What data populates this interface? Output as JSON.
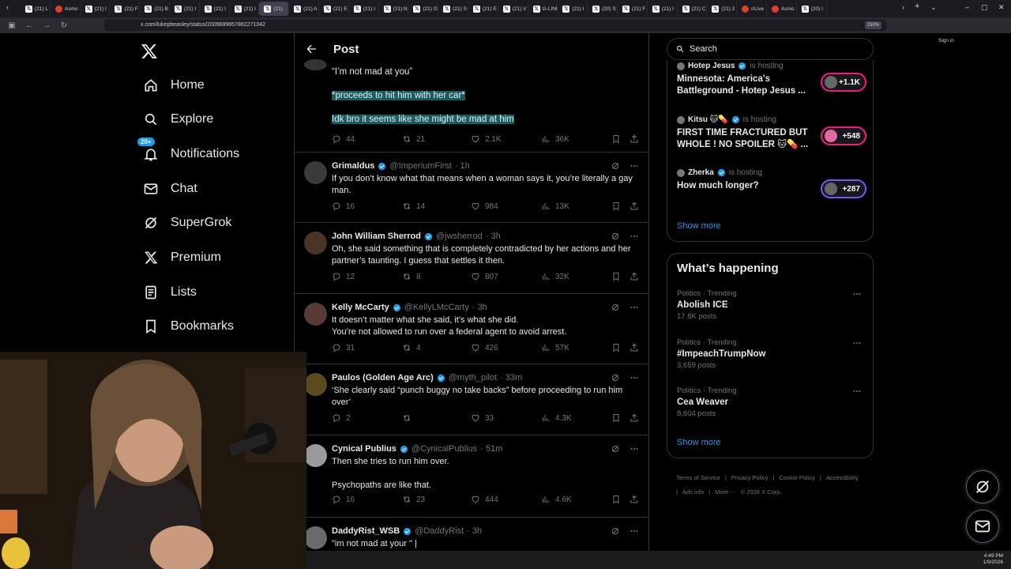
{
  "browser": {
    "tabs": [
      "(21) L",
      "Asmo",
      "(21) I",
      "(21) F",
      "(21) B",
      "(21) I",
      "(21) I",
      "(21) I",
      "(21)",
      "(21) A",
      "(21) E",
      "(21) I",
      "(21) N",
      "(21) G",
      "(21) S",
      "(21) E",
      "(21) V",
      "G-LINE",
      "(21) I",
      "(20) S",
      "(21) F",
      "(21) I",
      "(21) C",
      "(21) 2",
      "r/Live",
      "Asmo",
      "(20) I"
    ],
    "active_tab_index": 8,
    "url": "x.com/lukepbeasley/status/2009699657862271042",
    "zoom": "150%",
    "signin": "Sign in"
  },
  "nav": {
    "logo": "X",
    "items": [
      {
        "label": "Home",
        "icon": "home-icon"
      },
      {
        "label": "Explore",
        "icon": "search-icon"
      },
      {
        "label": "Notifications",
        "icon": "bell-icon",
        "badge": "20+"
      },
      {
        "label": "Chat",
        "icon": "mail-icon"
      },
      {
        "label": "SuperGrok",
        "icon": "grok-icon"
      },
      {
        "label": "Premium",
        "icon": "x-premium-icon"
      },
      {
        "label": "Lists",
        "icon": "list-icon"
      },
      {
        "label": "Bookmarks",
        "icon": "bookmark-icon"
      }
    ]
  },
  "header": {
    "title": "Post"
  },
  "top_post": {
    "lines": [
      "“I’m not mad at you”",
      "*proceeds to hit him with her car*",
      "Idk bro it seems like she might be mad at him"
    ],
    "stats": {
      "replies": "44",
      "reposts": "21",
      "likes": "2.1K",
      "views": "36K"
    }
  },
  "replies": [
    {
      "name": "Grimaldus",
      "handle": "@ImperiumFirst",
      "time": "· 1h",
      "text": "If you don’t know what that means when a woman says it, you’re literally a gay man.",
      "stats": {
        "replies": "16",
        "reposts": "14",
        "likes": "984",
        "views": "13K"
      }
    },
    {
      "name": "John William Sherrod",
      "handle": "@jwsherrod",
      "time": "· 3h",
      "text": "Oh, she said something that is completely contradicted by her actions and her partner’s taunting. I guess that settles it then.",
      "stats": {
        "replies": "12",
        "reposts": "8",
        "likes": "807",
        "views": "32K"
      }
    },
    {
      "name": "Kelly McCarty",
      "handle": "@KellyLMcCarty",
      "time": "· 3h",
      "text": "It doesn’t matter what she said, it’s what she did.\nYou’re not allowed to run over a federal agent to avoid arrest.",
      "stats": {
        "replies": "31",
        "reposts": "4",
        "likes": "426",
        "views": "57K"
      }
    },
    {
      "name": "Paulos (Golden Age Arc)",
      "handle": "@myth_pilot",
      "time": "· 33m",
      "text": "‘She clearly said “punch buggy no take backs” before proceeding to run him over’",
      "stats": {
        "replies": "2",
        "reposts": "",
        "likes": "33",
        "views": "4.3K"
      }
    },
    {
      "name": "Cynical Publius",
      "handle": "@CynicalPublius",
      "time": "· 51m",
      "text": "Then she tries to run him over.\n\nPsychopaths are like that.",
      "stats": {
        "replies": "16",
        "reposts": "23",
        "likes": "444",
        "views": "4.6K"
      }
    },
    {
      "name": "DaddyRist_WSB",
      "handle": "@DaddyRist",
      "time": "· 3h",
      "text": "\"im not mad at your \" |",
      "stats": null
    }
  ],
  "search": {
    "placeholder": "Search"
  },
  "spaces": [
    {
      "host": "Hotep Jesus",
      "status": "is hosting",
      "title": "Minnesota: America's Battleground - Hotep Jesus ...",
      "count": "+1.1K",
      "color": "#f91880"
    },
    {
      "host": "Kitsu 🐱💊",
      "status": "is hosting",
      "title": "FIRST TIME FRACTURED BUT WHOLE ! NO SPOILER 🐱💊 ...",
      "count": "+548",
      "color": "#f91880"
    },
    {
      "host": "Zherka",
      "status": "is hosting",
      "title": "How much longer?",
      "count": "+287",
      "color": "#7856ff"
    }
  ],
  "spaces_show_more": "Show more",
  "happening": {
    "title": "What’s happening",
    "trends": [
      {
        "meta": "Politics · Trending",
        "name": "Abolish ICE",
        "count": "17.8K posts"
      },
      {
        "meta": "Politics · Trending",
        "name": "#ImpeachTrumpNow",
        "count": "3,659 posts"
      },
      {
        "meta": "Politics · Trending",
        "name": "Cea Weaver",
        "count": "8,604 posts"
      }
    ],
    "show_more": "Show more"
  },
  "footer": [
    "Terms of Service",
    "|",
    "Privacy Policy",
    "|",
    "Cookie Policy",
    "|",
    "Accessibility",
    "|",
    "Ads info",
    "|",
    "More ···",
    "© 2026 X Corp."
  ],
  "taskbar": {
    "time": "4:49 PM",
    "date": "1/9/2026"
  },
  "colors": {
    "accent": "#1d9bf0",
    "like": "#71767b",
    "highlight": "#1d5b63",
    "space_pink": "#f91880",
    "space_purple": "#7856ff"
  }
}
